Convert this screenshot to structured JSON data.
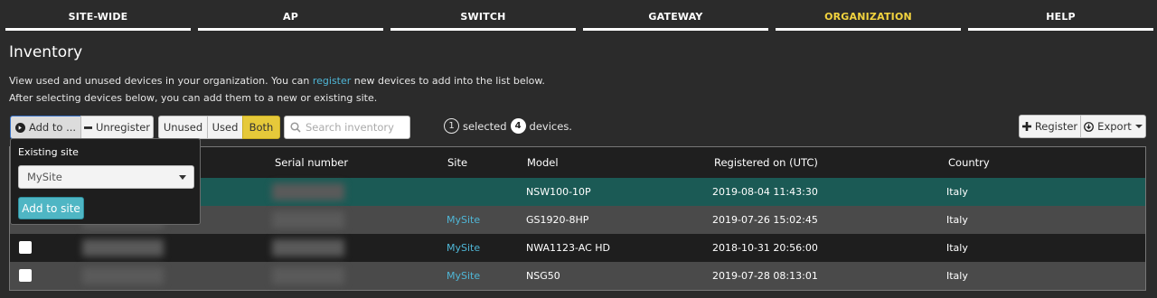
{
  "nav": {
    "tabs": [
      {
        "label": "SITE-WIDE"
      },
      {
        "label": "AP"
      },
      {
        "label": "SWITCH"
      },
      {
        "label": "GATEWAY"
      },
      {
        "label": "ORGANIZATION",
        "active": true
      },
      {
        "label": "HELP"
      }
    ]
  },
  "page": {
    "title": "Inventory",
    "desc_line1_pre": "View used and unused devices in your organization. You can ",
    "desc_line1_link": "register",
    "desc_line1_post": " new devices to add into the list below.",
    "desc_line2": "After selecting devices below, you can add them to a new or existing site."
  },
  "toolbar": {
    "add_to_label": "Add to ...",
    "unregister_label": "Unregister",
    "filter": {
      "unused": "Unused",
      "used": "Used",
      "both": "Both",
      "selected": "Both"
    },
    "search_placeholder": "Search inventory",
    "selected_count": "1",
    "selected_text": "selected",
    "device_count": "4",
    "devices_text": "devices.",
    "register_label": "Register",
    "export_label": "Export"
  },
  "popover": {
    "label": "Existing site",
    "selected_site": "MySite",
    "add_button": "Add to site"
  },
  "table": {
    "headers": {
      "serial": "Serial number",
      "site": "Site",
      "model": "Model",
      "registered": "Registered on (UTC)",
      "country": "Country"
    },
    "rows": [
      {
        "site": "",
        "model": "NSW100-10P",
        "registered": "2019-08-04 11:43:30",
        "country": "Italy",
        "selected": true
      },
      {
        "site": "MySite",
        "model": "GS1920-8HP",
        "registered": "2019-07-26 15:02:45",
        "country": "Italy"
      },
      {
        "site": "MySite",
        "model": "NWA1123-AC HD",
        "registered": "2018-10-31 20:56:00",
        "country": "Italy"
      },
      {
        "site": "MySite",
        "model": "NSG50",
        "registered": "2019-07-28 08:13:01",
        "country": "Italy"
      }
    ]
  },
  "colors": {
    "accent": "#f2d33f",
    "link": "#4fb6d6",
    "selected_row": "#1b5a55",
    "button_primary": "#4fb6c4"
  }
}
